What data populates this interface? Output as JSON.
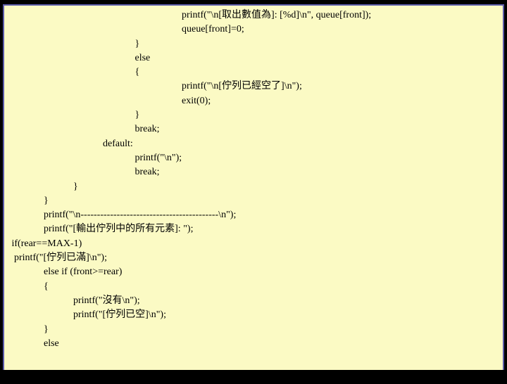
{
  "code": {
    "lines": [
      "                                                                        printf(\"\\n[取出數值為]: [%d]\\n\", queue[front]);",
      "                                                                        queue[front]=0;",
      "                                                     }",
      "                                                     else",
      "                                                     {",
      "                                                                        printf(\"\\n[佇列已經空了]\\n\");",
      "                                                                        exit(0);",
      "                                                     }",
      "                                                     break;",
      "                                        default:",
      "                                                     printf(\"\\n\");",
      "                                                     break;",
      "                            }",
      "                }",
      "                printf(\"\\n------------------------------------------\\n\");",
      "                printf(\"[輸出佇列中的所有元素]: \");",
      "",
      "   if(rear==MAX-1)",
      "    printf(\"[佇列已滿]\\n\");",
      "                else if (front>=rear)",
      "                {",
      "                            printf(\"沒有\\n\");",
      "                            printf(\"[佇列已空]\\n\");",
      "                }",
      "                else"
    ]
  }
}
